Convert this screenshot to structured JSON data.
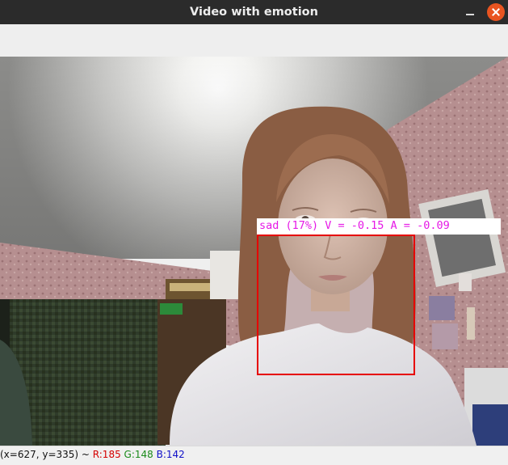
{
  "window": {
    "title": "Video with emotion"
  },
  "detection": {
    "label": "sad (17%) V = -0.15 A = -0.09",
    "box_color": "#e60000",
    "label_color": "#e619e6"
  },
  "status": {
    "coords": "(x=627, y=335) ~ ",
    "r": "R:185",
    "g": "G:148",
    "b": "B:142"
  },
  "icons": {
    "minimize": "minimize-icon",
    "close": "close-icon"
  },
  "colors": {
    "titlebar": "#2b2b2b",
    "close_button": "#e95420"
  }
}
